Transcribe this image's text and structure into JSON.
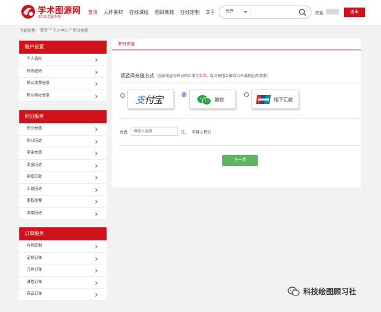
{
  "header": {
    "logo_title": "学术图源网",
    "logo_subtitle": "SCI论文图专用",
    "nav": [
      "首页",
      "元件素材",
      "在线课程",
      "图研商城",
      "在线定制",
      "关于"
    ],
    "search_select": "元件",
    "search_placeholder": "",
    "greeting": "欢迎,",
    "logout": "退出"
  },
  "breadcrumb": [
    "当前位置：",
    "首页",
    ">",
    "个人中心",
    ">",
    "积分充值"
  ],
  "sidebar": {
    "account": {
      "title": "账户设置",
      "items": [
        "个人资料",
        "修改密码",
        "默认发票信息",
        "默认地址信息"
      ]
    },
    "points": {
      "title": "积分服务",
      "items": [
        "积分充值",
        "积分历史",
        "资金充值",
        "资金历史",
        "新增汇款",
        "汇款历史",
        "索取发票",
        "发票历史"
      ]
    },
    "orders": {
      "title": "订单服务",
      "items": [
        "在线定制",
        "定制订单",
        "元件订单",
        "课程订单",
        "商品订单"
      ]
    }
  },
  "main": {
    "tab": "积分充值",
    "method_title": "请选择充值方式",
    "method_note_prefix": "（当前现金与积分的汇率为",
    "method_ratio": "1:5",
    "method_note_suffix": "；每次充值后都可以开具相应的发票）",
    "payments": {
      "alipay_a": "支",
      "alipay_b": "付宝",
      "wechat": "微信",
      "offline": "线下汇款"
    },
    "selected_payment": "wechat",
    "amount_label": "充值:",
    "amount_placeholder": "请输入金额",
    "amount_unit": "元,",
    "exchange_prefix": "可得",
    "exchange_points": "0",
    "exchange_suffix": "积分",
    "next_button": "下一步"
  },
  "watermark": "科技绘图顾习社",
  "colors": {
    "brand_red": "#d0121b",
    "next_green": "#5cb85c",
    "page_bg": "#f2f2f2"
  }
}
